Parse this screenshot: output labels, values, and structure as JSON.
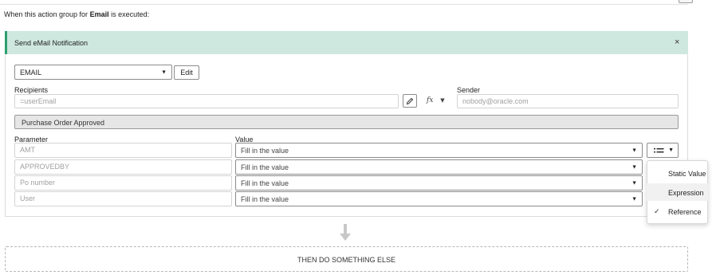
{
  "intro": {
    "prefix": "When this action group for ",
    "bold": "Email",
    "suffix": " is executed:"
  },
  "card": {
    "title": "Send eMail Notification",
    "close_symbol": "×",
    "template_select": {
      "value": "EMAIL",
      "caret": "▼"
    },
    "edit_label": "Edit",
    "recipients": {
      "label": "Recipients",
      "value": "=userEmail",
      "fx_label": "fx",
      "fx_caret": "▼"
    },
    "sender": {
      "label": "Sender",
      "placeholder": "nobody@oracle.com"
    },
    "template_name": "Purchase Order Approved",
    "parameters": {
      "param_header": "Parameter",
      "value_header": "Value",
      "rows": [
        {
          "param": "AMT",
          "value": "Fill in the value"
        },
        {
          "param": "APPROVEDBY",
          "value": "Fill in the value"
        },
        {
          "param": "Po number",
          "value": "Fill in the value"
        },
        {
          "param": "User",
          "value": "Fill in the value"
        }
      ],
      "value_type_caret": "▼"
    }
  },
  "value_type_menu": {
    "items": [
      {
        "label": "Static Value",
        "selected": false,
        "highlighted": false
      },
      {
        "label": "Expression",
        "selected": false,
        "highlighted": true
      },
      {
        "label": "Reference",
        "selected": true,
        "highlighted": false
      }
    ],
    "check_symbol": "✓"
  },
  "next_step_label": "THEN DO SOMETHING ELSE",
  "colors": {
    "header_bg": "#cfe8df",
    "header_accent": "#2e9f6e",
    "arrow": "#c8c8c8"
  }
}
